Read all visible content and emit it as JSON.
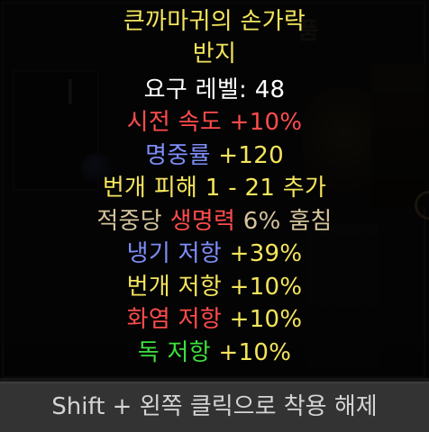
{
  "colors": {
    "title_gold": "#f4e55c",
    "white": "#ffffff",
    "red": "#ff4c4c",
    "blue": "#7f8ef8",
    "tan": "#d4c39c",
    "green": "#3ee03e",
    "hint": "#d4d4d4"
  },
  "background": {
    "header_fragment": "품"
  },
  "item": {
    "name": "큰까마귀의 손가락",
    "type": "반지",
    "required_level": {
      "label": "요구 레벨: ",
      "value": "48"
    },
    "mods": [
      {
        "parts": [
          {
            "text": "시전 속도 +10%",
            "color": "red"
          }
        ]
      },
      {
        "parts": [
          {
            "text": "명중률",
            "color": "blue"
          },
          {
            "text": " +120",
            "color": "title_gold"
          }
        ]
      },
      {
        "parts": [
          {
            "text": "번개 피해 1 - 21 추가",
            "color": "title_gold"
          }
        ]
      },
      {
        "parts": [
          {
            "text": "적중당 ",
            "color": "tan"
          },
          {
            "text": "생명력",
            "color": "red"
          },
          {
            "text": " 6% 훔침",
            "color": "tan"
          }
        ]
      },
      {
        "parts": [
          {
            "text": "냉기 저항",
            "color": "blue"
          },
          {
            "text": " +39%",
            "color": "title_gold"
          }
        ]
      },
      {
        "parts": [
          {
            "text": "번개 저항 +10%",
            "color": "title_gold"
          }
        ]
      },
      {
        "parts": [
          {
            "text": "화염 저항",
            "color": "red"
          },
          {
            "text": " +10%",
            "color": "title_gold"
          }
        ]
      },
      {
        "parts": [
          {
            "text": "독 저항",
            "color": "green"
          },
          {
            "text": " +10%",
            "color": "title_gold"
          }
        ]
      }
    ]
  },
  "hint": {
    "text": "Shift + 왼쪽 클릭으로 착용 해제"
  }
}
